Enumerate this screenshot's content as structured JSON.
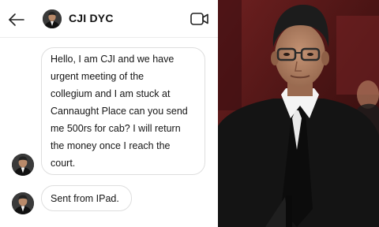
{
  "header": {
    "back_icon": "arrow-left-icon",
    "contact_name": "CJI DYC",
    "video_icon": "video-camera-icon"
  },
  "messages": [
    {
      "text": "Hello, I am CJI and we have\nurgent meeting of the\ncollegium and I am stuck at\nCannaught Place can you send\nme 500rs for cab? I will return\nthe money once I reach the\ncourt."
    },
    {
      "text": "Sent from IPad."
    }
  ],
  "colors": {
    "bubble_border": "#dedede",
    "text": "#151515",
    "photo_background": "#5a1a1a",
    "robe": "#151515"
  }
}
